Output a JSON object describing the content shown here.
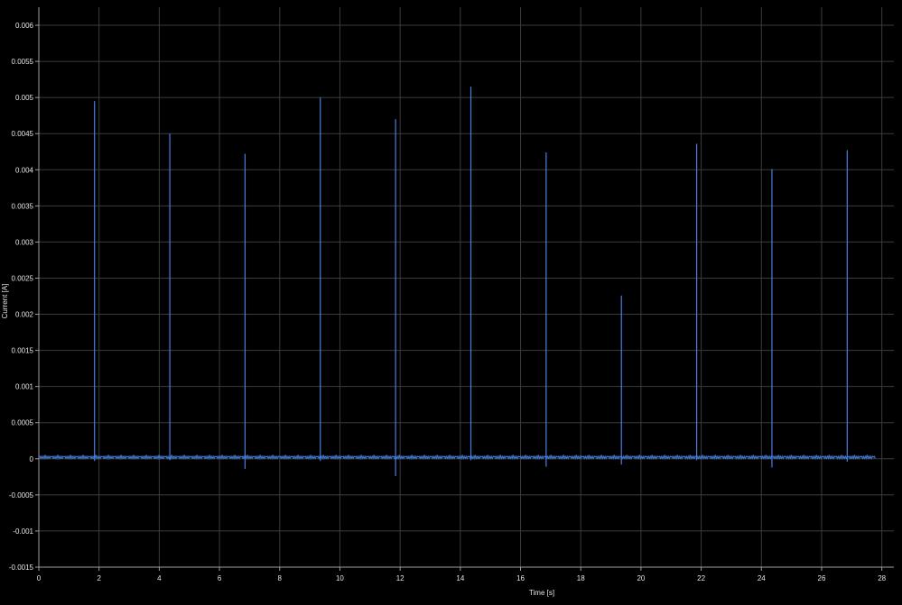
{
  "chart_data": {
    "type": "line",
    "title": "",
    "xlabel": "Time [s]",
    "ylabel": "Current [A]",
    "xlim": [
      0,
      28.4
    ],
    "ylim": [
      -0.0015,
      0.00625
    ],
    "x_ticks": [
      0,
      2,
      4,
      6,
      8,
      10,
      12,
      14,
      16,
      18,
      20,
      22,
      24,
      26,
      28
    ],
    "y_ticks": [
      -0.0015,
      -0.001,
      -0.0005,
      0,
      0.0005,
      0.001,
      0.0015,
      0.002,
      0.0025,
      0.003,
      0.0035,
      0.004,
      0.0045,
      0.005,
      0.0055,
      0.006
    ],
    "x_tick_labels": [
      "0",
      "2",
      "4",
      "6",
      "8",
      "10",
      "12",
      "14",
      "16",
      "18",
      "20",
      "22",
      "24",
      "26",
      "28"
    ],
    "y_tick_labels": [
      "-0.0015",
      "-0.001",
      "-0.0005",
      "0",
      "0.0005",
      "0.001",
      "0.0015",
      "0.002",
      "0.0025",
      "0.003",
      "0.0035",
      "0.004",
      "0.0045",
      "0.005",
      "0.0055",
      "0.006"
    ],
    "grid": true,
    "background_color": "#000000",
    "grid_color": "#3c3c3c",
    "series": [
      {
        "color": "#4a7fe0",
        "baseline": 2e-05,
        "x_start": 0,
        "x_end": 27.8,
        "spikes": [
          {
            "x": 1.85,
            "peak": 0.00495,
            "trough": -3e-05
          },
          {
            "x": 4.35,
            "peak": 0.0045,
            "trough": -2e-05
          },
          {
            "x": 6.85,
            "peak": 0.00422,
            "trough": -0.00014
          },
          {
            "x": 9.35,
            "peak": 0.005,
            "trough": -3e-05
          },
          {
            "x": 11.85,
            "peak": 0.0047,
            "trough": -0.00024
          },
          {
            "x": 14.35,
            "peak": 0.00515,
            "trough": -2e-05
          },
          {
            "x": 16.85,
            "peak": 0.00424,
            "trough": -0.00011
          },
          {
            "x": 19.35,
            "peak": 0.00226,
            "trough": -8e-05
          },
          {
            "x": 21.85,
            "peak": 0.00436,
            "trough": -2e-05
          },
          {
            "x": 24.35,
            "peak": 0.00401,
            "trough": -0.00012
          },
          {
            "x": 26.85,
            "peak": 0.00427,
            "trough": -4e-05
          }
        ]
      }
    ]
  }
}
